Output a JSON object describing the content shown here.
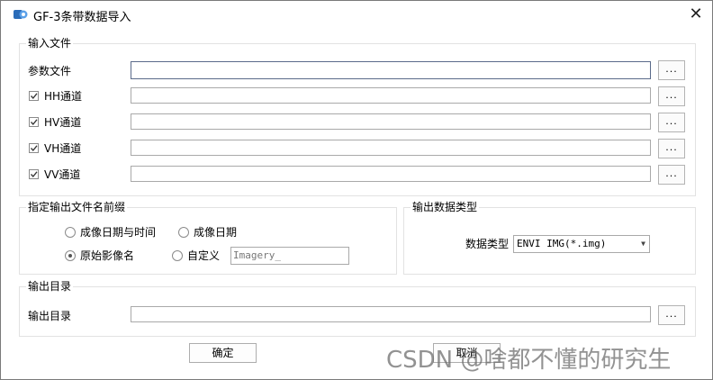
{
  "window": {
    "title": "GF-3条带数据导入",
    "close_glyph": "✕"
  },
  "input_group": {
    "legend": "输入文件",
    "param_label": "参数文件",
    "channels": [
      {
        "label": "HH通道",
        "checked": true
      },
      {
        "label": "HV通道",
        "checked": true
      },
      {
        "label": "VH通道",
        "checked": true
      },
      {
        "label": "VV通道",
        "checked": true
      }
    ],
    "browse_label": "..."
  },
  "prefix_group": {
    "legend": "指定输出文件名前缀",
    "options": [
      "成像日期与时间",
      "成像日期",
      "原始影像名",
      "自定义"
    ],
    "selected": "原始影像名",
    "custom_value": "Imagery_"
  },
  "datatype_group": {
    "legend": "输出数据类型",
    "label": "数据类型",
    "selected": "ENVI IMG(*.img)"
  },
  "output_group": {
    "legend": "输出目录",
    "label": "输出目录",
    "browse_label": "..."
  },
  "buttons": {
    "ok": "确定",
    "cancel": "取消"
  },
  "watermark": "CSDN @啥都不懂的研究生",
  "icons": {
    "app": "app-icon",
    "close": "close-icon",
    "check": "checkmark-icon",
    "dropdown": "chevron-down-icon"
  }
}
